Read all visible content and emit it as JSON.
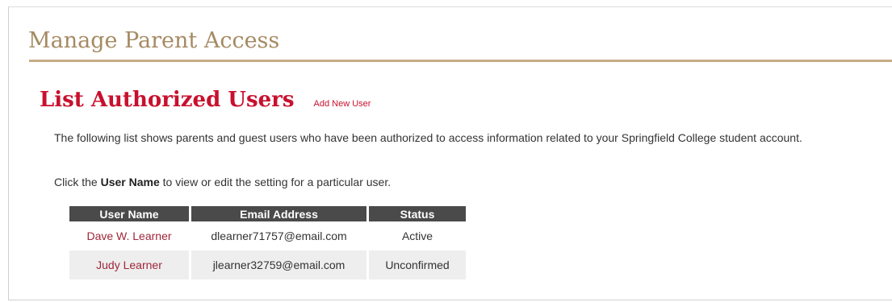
{
  "page": {
    "title": "Manage Parent Access"
  },
  "section": {
    "title": "List Authorized Users",
    "add_link": "Add New User"
  },
  "intro": {
    "text": "The following list shows parents and guest users who have been authorized to access information related to your Springfield College student account."
  },
  "instruction": {
    "prefix": "Click the ",
    "bold": "User Name",
    "suffix": " to view or edit the setting for a particular user."
  },
  "table": {
    "headers": {
      "user_name": "User Name",
      "email": "Email Address",
      "status": "Status"
    },
    "rows": [
      {
        "user_name": "Dave W. Learner",
        "email": "dlearner71757@email.com",
        "status": "Active"
      },
      {
        "user_name": "Judy Learner",
        "email": "jlearner32759@email.com",
        "status": "Unconfirmed"
      }
    ]
  },
  "colors": {
    "title_tan": "#a58a62",
    "rule_tan": "#c7ad86",
    "accent_red": "#c8102e",
    "link_red": "#a0263a",
    "header_dark": "#4a4a4a",
    "row_alt": "#eeeeee"
  }
}
